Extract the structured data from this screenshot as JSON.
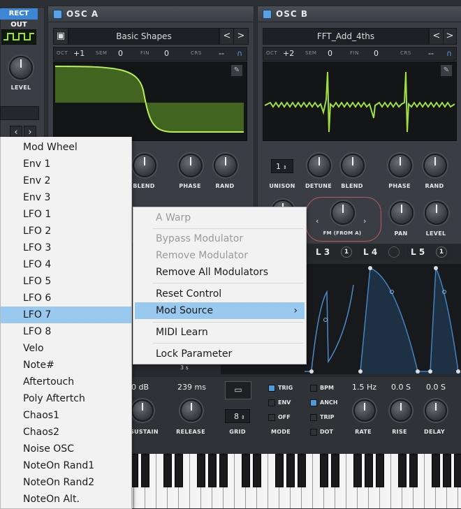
{
  "left_strip": {
    "direct_out": "RECT OUT",
    "level_label": "LEVEL"
  },
  "osc_a": {
    "title": "OSC A",
    "preset": "Basic Shapes",
    "prev": "<",
    "next": ">",
    "tune": [
      {
        "label": "OCT",
        "value": "+1"
      },
      {
        "label": "SEM",
        "value": "0"
      },
      {
        "label": "FIN",
        "value": "0"
      },
      {
        "label": "CRS",
        "value": "--"
      }
    ],
    "knobs": {
      "blend": "BLEND",
      "phase": "PHASE",
      "rand": "RAND"
    }
  },
  "osc_b": {
    "title": "OSC B",
    "preset": "FFT_Add_4ths",
    "prev": "<",
    "next": ">",
    "tune": [
      {
        "label": "OCT",
        "value": "+2"
      },
      {
        "label": "SEM",
        "value": "0"
      },
      {
        "label": "FIN",
        "value": "0"
      },
      {
        "label": "CRS",
        "value": "--"
      }
    ],
    "unison_value": "1",
    "knobs": {
      "unison": "UNISON",
      "detune": "DETUNE",
      "blend": "BLEND",
      "phase": "PHASE",
      "rand": "RAND",
      "fm": "FM (FROM A)",
      "pan": "PAN",
      "level": "LEVEL"
    }
  },
  "lfo_tabs": [
    {
      "label": "L 3",
      "count": "1"
    },
    {
      "label": "L 4",
      "count": ""
    },
    {
      "label": "L 5",
      "count": "1"
    }
  ],
  "lfo_controls": {
    "grid_value": "8",
    "grid_label": "GRID",
    "mode_label": "MODE",
    "checks": [
      {
        "label": "TRIG",
        "on": true
      },
      {
        "label": "ENV",
        "on": false
      },
      {
        "label": "OFF",
        "on": false
      },
      {
        "label": "BPM",
        "on": false
      },
      {
        "label": "ANCH",
        "on": true
      },
      {
        "label": "TRIP",
        "on": false
      },
      {
        "label": "DOT",
        "on": false
      }
    ],
    "rate_value": "1.5 Hz",
    "rise_value": "0.0 S",
    "delay_value": "0.0 S",
    "rate": "RATE",
    "rise": "RISE",
    "delay": "DELAY",
    "time_hint": "3 s"
  },
  "env": {
    "sustain_value": "0 dB",
    "release_value": "239 ms",
    "sustain": "SUSTAIN",
    "release": "RELEASE"
  },
  "mod_source_menu": {
    "items": [
      "Mod Wheel",
      "Env 1",
      "Env 2",
      "Env 3",
      "LFO 1",
      "LFO 2",
      "LFO 3",
      "LFO 4",
      "LFO 5",
      "LFO 6",
      "LFO 7",
      "LFO 8",
      "Velo",
      "Note#",
      "Aftertouch",
      "Poly Aftertch",
      "Chaos1",
      "Chaos2",
      "Noise OSC",
      "NoteOn Rand1",
      "NoteOn Rand2",
      "NoteOn Alt."
    ],
    "selected_index": 10
  },
  "context_menu": {
    "header": "A Warp",
    "bypass": "Bypass Modulator",
    "remove": "Remove Modulator",
    "remove_all": "Remove All Modulators",
    "reset": "Reset Control",
    "mod_source": "Mod Source",
    "submenu_arrow": "›",
    "midi_learn": "MIDI Learn",
    "lock": "Lock Parameter"
  },
  "colors": {
    "accent": "#5aa0e6",
    "wave": "#9fe040",
    "menu_bg": "#f2f2f2",
    "menu_highlight": "#99c9ef"
  }
}
